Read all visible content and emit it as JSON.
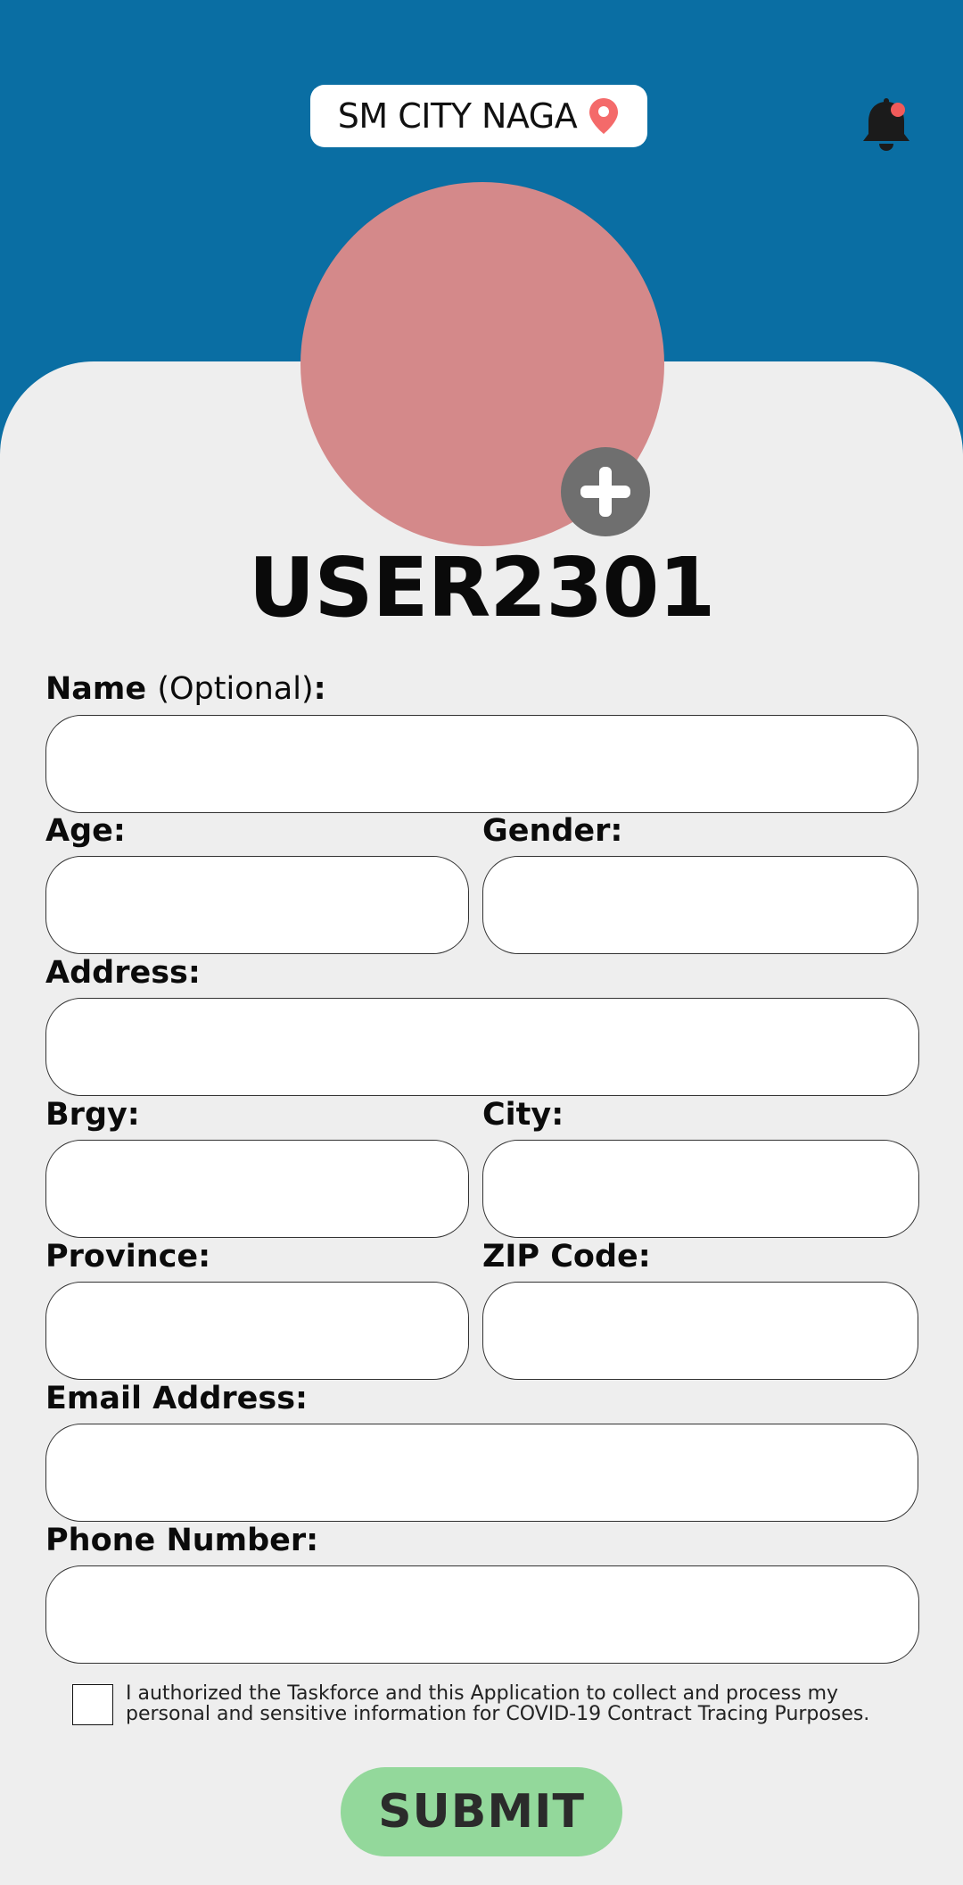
{
  "header": {
    "location": "SM CITY NAGA",
    "bg_color": "#0a6ea3",
    "location_icon": "map-pin-icon",
    "notification_icon": "bell-icon",
    "notification_dot_color": "#f05a5a"
  },
  "profile": {
    "avatar_color": "#d4898a",
    "add_photo_icon": "plus-icon",
    "username": "USER2301"
  },
  "form": {
    "name_label": "Name",
    "name_optional": "(Optional)",
    "name_colon": ":",
    "name_value": "",
    "age_label": "Age:",
    "age_value": "",
    "gender_label": "Gender:",
    "gender_value": "",
    "address_label": "Address:",
    "address_value": "",
    "brgy_label": "Brgy:",
    "brgy_value": "",
    "city_label": "City:",
    "city_value": "",
    "province_label": "Province:",
    "province_value": "",
    "zip_label": "ZIP Code:",
    "zip_value": "",
    "email_label": "Email Address:",
    "email_value": "",
    "phone_label": "Phone Number:",
    "phone_value": "",
    "consent_text": "I authorized the Taskforce and this Application to collect and process my personal and sensitive information for COVID-19 Contract Tracing Purposes.",
    "consent_checked": false,
    "submit_label": "SUBMIT",
    "submit_color": "#93d89b"
  }
}
